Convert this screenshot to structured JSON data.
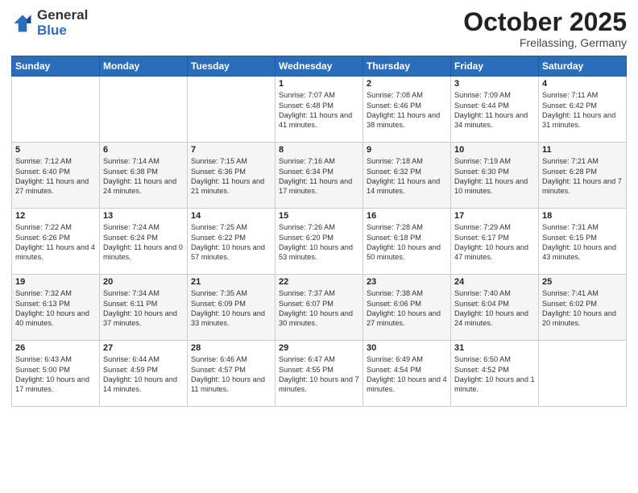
{
  "header": {
    "logo_general": "General",
    "logo_blue": "Blue",
    "title": "October 2025",
    "location": "Freilassing, Germany"
  },
  "days_of_week": [
    "Sunday",
    "Monday",
    "Tuesday",
    "Wednesday",
    "Thursday",
    "Friday",
    "Saturday"
  ],
  "weeks": [
    [
      {
        "day": "",
        "info": ""
      },
      {
        "day": "",
        "info": ""
      },
      {
        "day": "",
        "info": ""
      },
      {
        "day": "1",
        "info": "Sunrise: 7:07 AM\nSunset: 6:48 PM\nDaylight: 11 hours\nand 41 minutes."
      },
      {
        "day": "2",
        "info": "Sunrise: 7:08 AM\nSunset: 6:46 PM\nDaylight: 11 hours\nand 38 minutes."
      },
      {
        "day": "3",
        "info": "Sunrise: 7:09 AM\nSunset: 6:44 PM\nDaylight: 11 hours\nand 34 minutes."
      },
      {
        "day": "4",
        "info": "Sunrise: 7:11 AM\nSunset: 6:42 PM\nDaylight: 11 hours\nand 31 minutes."
      }
    ],
    [
      {
        "day": "5",
        "info": "Sunrise: 7:12 AM\nSunset: 6:40 PM\nDaylight: 11 hours\nand 27 minutes."
      },
      {
        "day": "6",
        "info": "Sunrise: 7:14 AM\nSunset: 6:38 PM\nDaylight: 11 hours\nand 24 minutes."
      },
      {
        "day": "7",
        "info": "Sunrise: 7:15 AM\nSunset: 6:36 PM\nDaylight: 11 hours\nand 21 minutes."
      },
      {
        "day": "8",
        "info": "Sunrise: 7:16 AM\nSunset: 6:34 PM\nDaylight: 11 hours\nand 17 minutes."
      },
      {
        "day": "9",
        "info": "Sunrise: 7:18 AM\nSunset: 6:32 PM\nDaylight: 11 hours\nand 14 minutes."
      },
      {
        "day": "10",
        "info": "Sunrise: 7:19 AM\nSunset: 6:30 PM\nDaylight: 11 hours\nand 10 minutes."
      },
      {
        "day": "11",
        "info": "Sunrise: 7:21 AM\nSunset: 6:28 PM\nDaylight: 11 hours\nand 7 minutes."
      }
    ],
    [
      {
        "day": "12",
        "info": "Sunrise: 7:22 AM\nSunset: 6:26 PM\nDaylight: 11 hours\nand 4 minutes."
      },
      {
        "day": "13",
        "info": "Sunrise: 7:24 AM\nSunset: 6:24 PM\nDaylight: 11 hours\nand 0 minutes."
      },
      {
        "day": "14",
        "info": "Sunrise: 7:25 AM\nSunset: 6:22 PM\nDaylight: 10 hours\nand 57 minutes."
      },
      {
        "day": "15",
        "info": "Sunrise: 7:26 AM\nSunset: 6:20 PM\nDaylight: 10 hours\nand 53 minutes."
      },
      {
        "day": "16",
        "info": "Sunrise: 7:28 AM\nSunset: 6:18 PM\nDaylight: 10 hours\nand 50 minutes."
      },
      {
        "day": "17",
        "info": "Sunrise: 7:29 AM\nSunset: 6:17 PM\nDaylight: 10 hours\nand 47 minutes."
      },
      {
        "day": "18",
        "info": "Sunrise: 7:31 AM\nSunset: 6:15 PM\nDaylight: 10 hours\nand 43 minutes."
      }
    ],
    [
      {
        "day": "19",
        "info": "Sunrise: 7:32 AM\nSunset: 6:13 PM\nDaylight: 10 hours\nand 40 minutes."
      },
      {
        "day": "20",
        "info": "Sunrise: 7:34 AM\nSunset: 6:11 PM\nDaylight: 10 hours\nand 37 minutes."
      },
      {
        "day": "21",
        "info": "Sunrise: 7:35 AM\nSunset: 6:09 PM\nDaylight: 10 hours\nand 33 minutes."
      },
      {
        "day": "22",
        "info": "Sunrise: 7:37 AM\nSunset: 6:07 PM\nDaylight: 10 hours\nand 30 minutes."
      },
      {
        "day": "23",
        "info": "Sunrise: 7:38 AM\nSunset: 6:06 PM\nDaylight: 10 hours\nand 27 minutes."
      },
      {
        "day": "24",
        "info": "Sunrise: 7:40 AM\nSunset: 6:04 PM\nDaylight: 10 hours\nand 24 minutes."
      },
      {
        "day": "25",
        "info": "Sunrise: 7:41 AM\nSunset: 6:02 PM\nDaylight: 10 hours\nand 20 minutes."
      }
    ],
    [
      {
        "day": "26",
        "info": "Sunrise: 6:43 AM\nSunset: 5:00 PM\nDaylight: 10 hours\nand 17 minutes."
      },
      {
        "day": "27",
        "info": "Sunrise: 6:44 AM\nSunset: 4:59 PM\nDaylight: 10 hours\nand 14 minutes."
      },
      {
        "day": "28",
        "info": "Sunrise: 6:46 AM\nSunset: 4:57 PM\nDaylight: 10 hours\nand 11 minutes."
      },
      {
        "day": "29",
        "info": "Sunrise: 6:47 AM\nSunset: 4:55 PM\nDaylight: 10 hours\nand 7 minutes."
      },
      {
        "day": "30",
        "info": "Sunrise: 6:49 AM\nSunset: 4:54 PM\nDaylight: 10 hours\nand 4 minutes."
      },
      {
        "day": "31",
        "info": "Sunrise: 6:50 AM\nSunset: 4:52 PM\nDaylight: 10 hours\nand 1 minute."
      },
      {
        "day": "",
        "info": ""
      }
    ]
  ]
}
